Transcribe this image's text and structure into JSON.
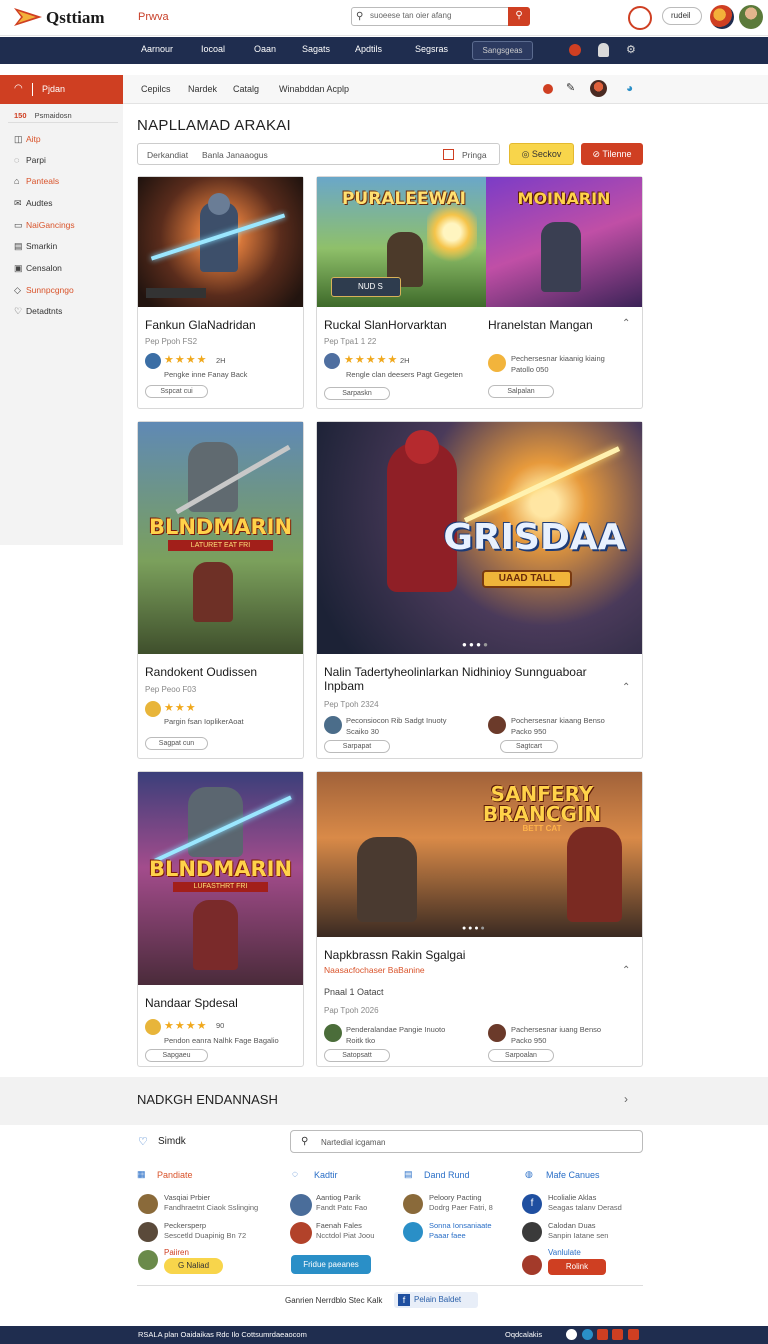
{
  "header": {
    "logo": "Qsttiam",
    "logo_sub": "Prwva",
    "search_placeholder": "suoeese tan oier afang",
    "user_label": "rudeil"
  },
  "nav": {
    "items": [
      "Aarnour",
      "Iocoal",
      "Oaan",
      "Sagats",
      "Apdtils",
      "Segsras"
    ],
    "pill": "Sangsgeas"
  },
  "sidebar": {
    "head": "Pjdan",
    "sub_count": "150",
    "sub_label": "Psmaidosn",
    "items": [
      {
        "label": "Aitp",
        "icon": "bag-icon",
        "active": true
      },
      {
        "label": "Parpi",
        "icon": "chat-icon",
        "active": false
      },
      {
        "label": "Panteals",
        "icon": "people-icon",
        "active": true
      },
      {
        "label": "Audtes",
        "icon": "mail-icon",
        "active": false
      },
      {
        "label": "NaiGancings",
        "icon": "card-icon",
        "active": true
      },
      {
        "label": "Smarkin",
        "icon": "doc-icon",
        "active": false
      },
      {
        "label": "Censalon",
        "icon": "image-icon",
        "active": false
      },
      {
        "label": "Sunnpcgngo",
        "icon": "tag-icon",
        "active": true
      },
      {
        "label": "Detadtnts",
        "icon": "heart-icon",
        "active": false
      }
    ]
  },
  "subbar": {
    "items": [
      "Cepilcs",
      "Nardek",
      "Catalg",
      "Winabddan Acplp"
    ]
  },
  "page": {
    "title": "NAPLLAMAD ARAKAI",
    "filter_left": "Derkandiat",
    "filter_mid": "Banla Janaaogus",
    "filter_right": "Pringa",
    "btn_yellow": "Seckov",
    "btn_red": "Tilenne"
  },
  "cards": [
    {
      "art": "",
      "title": "Fankun GlaNadridan",
      "meta": "Pep Ppoh FS2",
      "rating": "2H",
      "desc": "Pengke inne Fanay Back",
      "tag": "Sspcat cui"
    },
    {
      "art": "PURALEEWAI",
      "title": "Ruckal SlanHorvarktan",
      "meta": "Pep Tpa1 1 22",
      "rating": "2H",
      "desc": "Rengle clan deesers Pagt Gegeten",
      "tag": "Sarpaskn"
    },
    {
      "art": "MOINARIN",
      "title": "Hranelstan Mangan",
      "desc": "Pechersesnar kiaanig kiaing",
      "meta": "Patollo 050",
      "tag": "Salpalan"
    },
    {
      "art": "BLNDMARIN",
      "art_sub": "LATURET EAT FRI",
      "title": "Randokent Oudissen",
      "meta": "Pep Peoo F03",
      "desc": "Pargin fsan IoplikerAoat",
      "tag": "Sagpat cun"
    },
    {
      "art": "GRISDAA",
      "art_sub": "UAAD TALL",
      "title": "Nalin Tadertyheolinlarkan Nidhinioy Sunnguaboar Inpbam",
      "meta": "Pep Tpoh 2324",
      "u1": "Peconsiocon Rib Sadgt Inuoty",
      "u1b": "Scaiko 30",
      "u2": "Pochersesnar kiaang Benso",
      "u2b": "Packo 950",
      "tag": "Sarpapat",
      "tag2": "Sagtcart"
    },
    {
      "art": "BLNDMARIN",
      "art_sub": "LUFASTHRT FRI",
      "title": "Nandaar Spdesal",
      "rating": "90",
      "desc": "Pendon eanra Nalhk Fage Bagalio",
      "tag": "Sapgaeu"
    },
    {
      "art": "SANFERY BRANCGIN",
      "art_sub": "BETT CAT",
      "title": "Napkbrassn Rakin Sgalgai",
      "subtitle": "Naasacfochaser BaBanine",
      "extra": "Pnaal 1 Oatact",
      "meta": "Pap Tpoh 2026",
      "u1": "Penderalandae Pangie Inuoto",
      "u1b": "Roitk tko",
      "u2": "Pachersesnar iuang Benso",
      "u2b": "Packo 950",
      "tag": "Satopsatt",
      "tag2": "Sarpoalan"
    }
  ],
  "footer": {
    "section_title": "NADKGH ENDANNASH",
    "simdk": "Simdk",
    "search_placeholder": "Nartedial icgaman",
    "cols": [
      {
        "title": "Pandiate",
        "icon": "calendar-icon",
        "rows": [
          {
            "a": "Vasqiai Prbier",
            "b": "Fandhraetnt Ciaok Sslinging"
          },
          {
            "a": "Peckersperp",
            "b": "Sescetld Duapinig Bn 72"
          },
          {
            "a": "Paiiren",
            "b": ""
          }
        ],
        "btn": "G Naliad"
      },
      {
        "title": "Kadtir",
        "icon": "chat-icon",
        "rows": [
          {
            "a": "Aantiog Parik",
            "b": "Fandt Patc Fao"
          },
          {
            "a": "Faenah Fales",
            "b": "Ncctdol Piat Joou"
          }
        ],
        "btn": "Fridue paeanes"
      },
      {
        "title": "Dand Rund",
        "icon": "doc-icon",
        "rows": [
          {
            "a": "Peloory Pacting",
            "b": "Dodrg Paer Fatri, 8"
          },
          {
            "a": "Sonna Ionsaniaate",
            "b": "Paaar faee"
          }
        ],
        "btn": ""
      },
      {
        "title": "Mafe Canues",
        "icon": "globe-icon",
        "rows": [
          {
            "a": "Hcolialie Aklas",
            "b": "Seagas talanv Derasd"
          },
          {
            "a": "Calodan Duas",
            "b": "Sanpin Iatane sen"
          },
          {
            "a": "Vanlulate",
            "b": ""
          }
        ],
        "btn": "Rolink"
      }
    ],
    "share_label": "Ganrien Nerrdblo Stec Kalk",
    "share_btn": "Pelain Baldet",
    "bottom_left": "RSALA plan Oaidaikas Rdc Ilo Cottsumrdaeaocom",
    "bottom_right": "Oqdcalakis"
  },
  "colors": {
    "accent": "#cf3f22",
    "nav": "#1f2d4f",
    "star": "#f0a81c",
    "yellow": "#f8d54b",
    "link_orange": "#d9532a"
  }
}
